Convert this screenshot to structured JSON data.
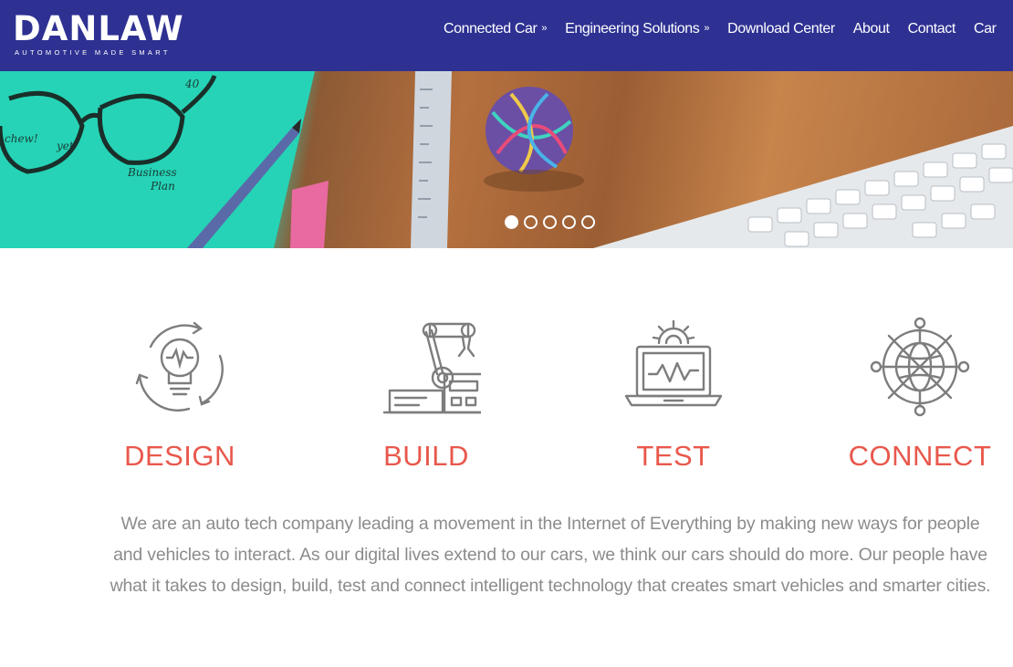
{
  "brand": {
    "name": "DANLAW",
    "tagline": "AUTOMOTIVE MADE SMART",
    "header_color": "#2e3192",
    "accent_color": "#e8584c"
  },
  "nav": {
    "items": [
      {
        "label": "Connected Car",
        "has_dropdown": true
      },
      {
        "label": "Engineering Solutions",
        "has_dropdown": true
      },
      {
        "label": "Download Center",
        "has_dropdown": false
      },
      {
        "label": "About",
        "has_dropdown": false
      },
      {
        "label": "Contact",
        "has_dropdown": false
      },
      {
        "label": "Car",
        "has_dropdown": false
      }
    ],
    "dropdown_icon": "double-chevron-down-icon"
  },
  "hero": {
    "slide_count": 5,
    "active_slide": 1,
    "sketch_text": [
      "chew!",
      "yet",
      "40",
      "Business",
      "Plan"
    ]
  },
  "pillars": [
    {
      "title": "DESIGN",
      "icon": "lightbulb-cycle-icon"
    },
    {
      "title": "BUILD",
      "icon": "robot-arm-icon"
    },
    {
      "title": "TEST",
      "icon": "laptop-waveform-icon"
    },
    {
      "title": "CONNECT",
      "icon": "globe-network-icon"
    }
  ],
  "description": "We are an auto tech company leading a movement in the Internet of Everything by making new ways for people and vehicles to interact. As our digital lives extend to our cars, we think our cars should do more. Our people have what it takes to design, build, test and connect intelligent technology that creates smart vehicles and smarter cities."
}
